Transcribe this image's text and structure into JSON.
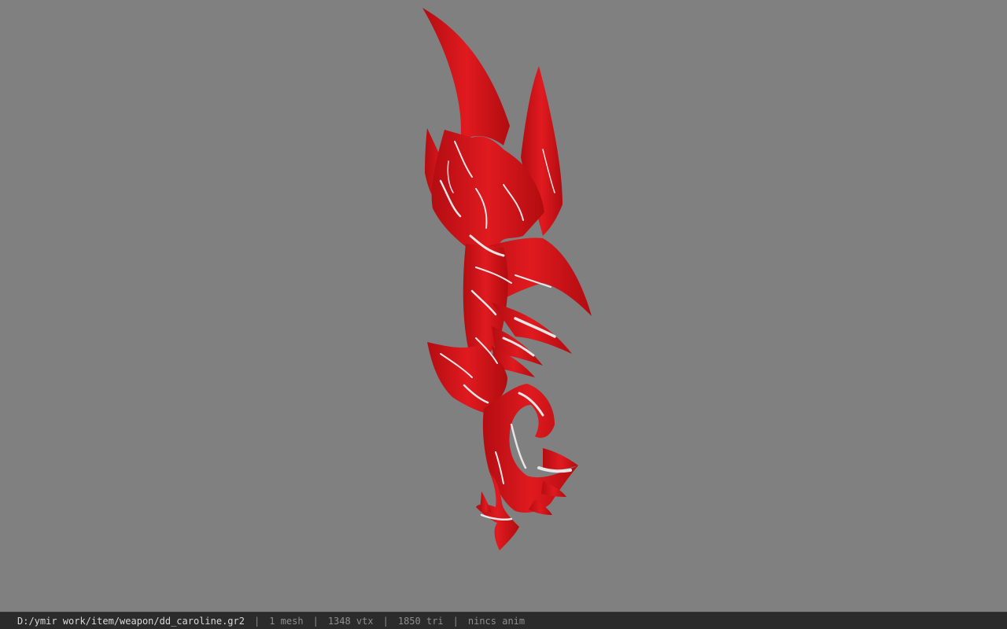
{
  "viewport": {
    "background_color": "#808080",
    "model": {
      "description_icon": "weapon-mesh",
      "primary_color": "#d4141a",
      "highlight_color": "#e8e8e8"
    }
  },
  "statusbar": {
    "file_path": "D:/ymir work/item/weapon/dd_caroline.gr2",
    "separator": "|",
    "mesh_count": "1 mesh",
    "vertex_count": "1348 vtx",
    "triangle_count": "1850 tri",
    "animation": "nincs anim"
  }
}
